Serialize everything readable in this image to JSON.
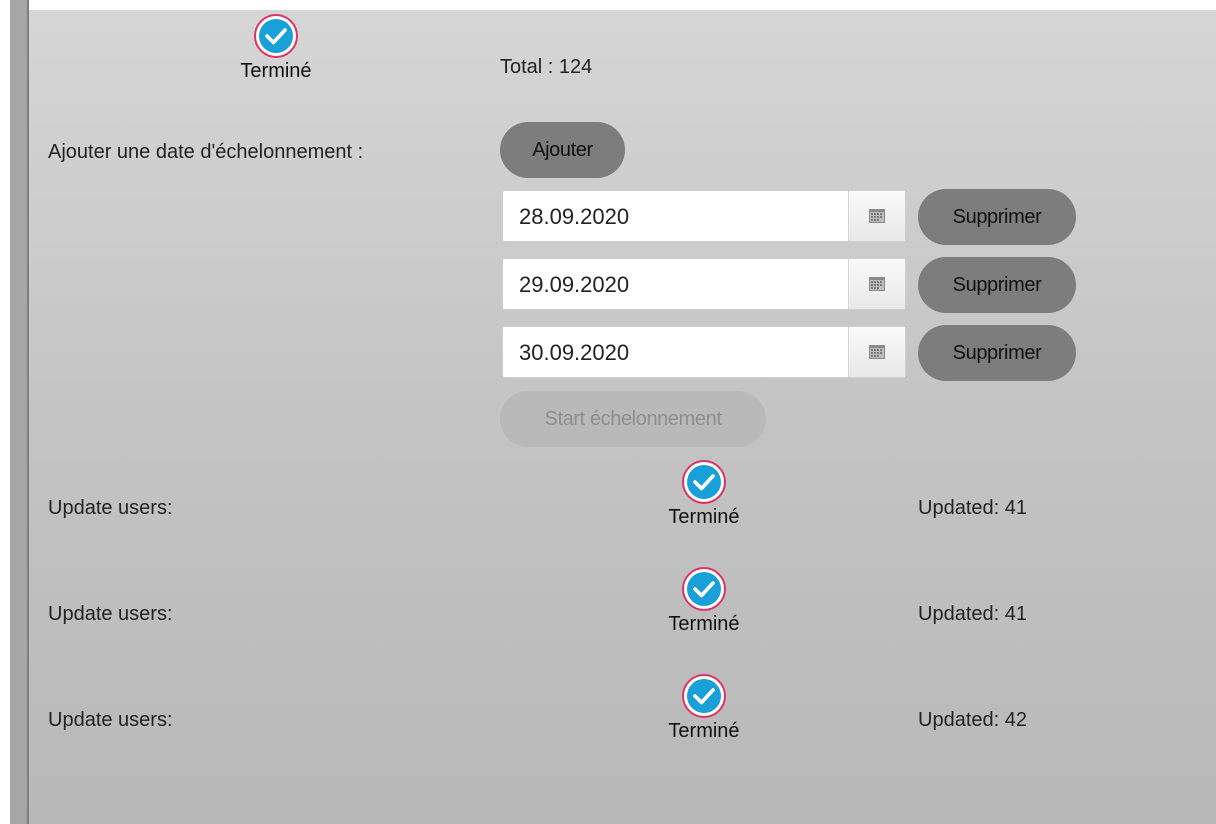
{
  "header": {
    "status_label": "Terminé",
    "total_text": "Total : 124"
  },
  "schedule": {
    "label": "Ajouter une date d'échelonnement :",
    "add_button": "Ajouter",
    "dates": [
      {
        "value": "28.09.2020",
        "remove_label": "Supprimer"
      },
      {
        "value": "29.09.2020",
        "remove_label": "Supprimer"
      },
      {
        "value": "30.09.2020",
        "remove_label": "Supprimer"
      }
    ],
    "start_button": "Start échelonnement"
  },
  "updates": [
    {
      "label": "Update users:",
      "status": "Terminé",
      "count_text": "Updated: 41"
    },
    {
      "label": "Update users:",
      "status": "Terminé",
      "count_text": "Updated: 41"
    },
    {
      "label": "Update users:",
      "status": "Terminé",
      "count_text": "Updated: 42"
    }
  ],
  "icons": {
    "status": "check-circle-icon",
    "calendar": "calendar-icon"
  },
  "colors": {
    "check_fill": "#1aa0d8",
    "check_ring": "#e0306a",
    "pill": "#7d7d7d",
    "pill_disabled": "#b9b9b9"
  }
}
